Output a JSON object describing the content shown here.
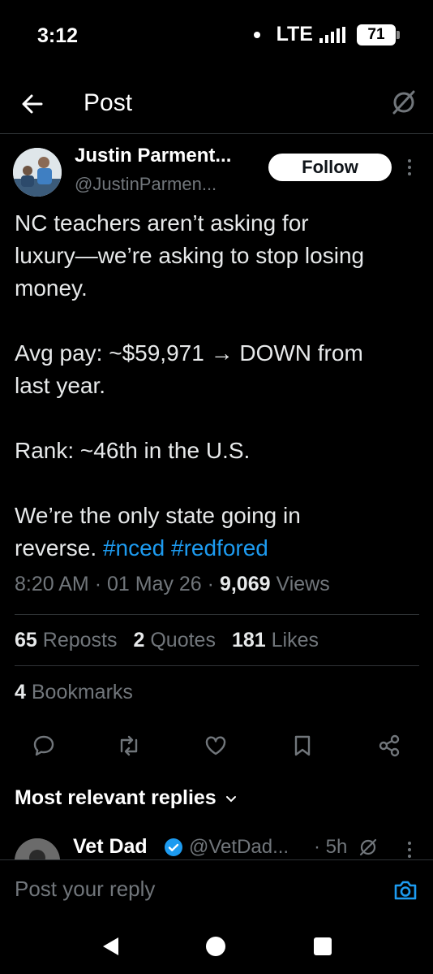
{
  "status_bar": {
    "time": "3:12",
    "network": "LTE",
    "battery": "71"
  },
  "header": {
    "title": "Post"
  },
  "author": {
    "name": "Justin Parment...",
    "handle": "@JustinParmen...",
    "follow_label": "Follow"
  },
  "tweet": {
    "lines": [
      "NC teachers aren’t asking for",
      "luxury—we’re asking to stop losing",
      "money.",
      "Avg pay: ~$59,971 → DOWN from",
      "last year.",
      "Rank: ~46th in the U.S.",
      "We’re the only state going in",
      "reverse."
    ],
    "hashtags": [
      "#nced",
      "#redfored"
    ],
    "time": "8:20 AM",
    "date": "01 May 26",
    "views_count": "9,069",
    "views_label": "Views",
    "separator": "·"
  },
  "stats": {
    "reposts_count": "65",
    "reposts_label": "Reposts",
    "quotes_count": "2",
    "quotes_label": "Quotes",
    "likes_count": "181",
    "likes_label": "Likes",
    "bookmarks_count": "4",
    "bookmarks_label": "Bookmarks"
  },
  "actions": [
    {
      "icon": "reply-icon"
    },
    {
      "icon": "repost-icon"
    },
    {
      "icon": "like-icon"
    },
    {
      "icon": "bookmark-icon"
    },
    {
      "icon": "share-icon"
    }
  ],
  "replies": {
    "sort_label": "Most relevant replies",
    "first_reply": {
      "name": "Vet Dad",
      "handle": "@VetDad...",
      "time": "· 5h"
    }
  },
  "compose": {
    "placeholder": "Post your reply"
  },
  "colors": {
    "background": "#000000",
    "text": "#e7e9ea",
    "muted": "#71767b",
    "accent": "#1d9bf0",
    "divider": "#2f3336"
  }
}
